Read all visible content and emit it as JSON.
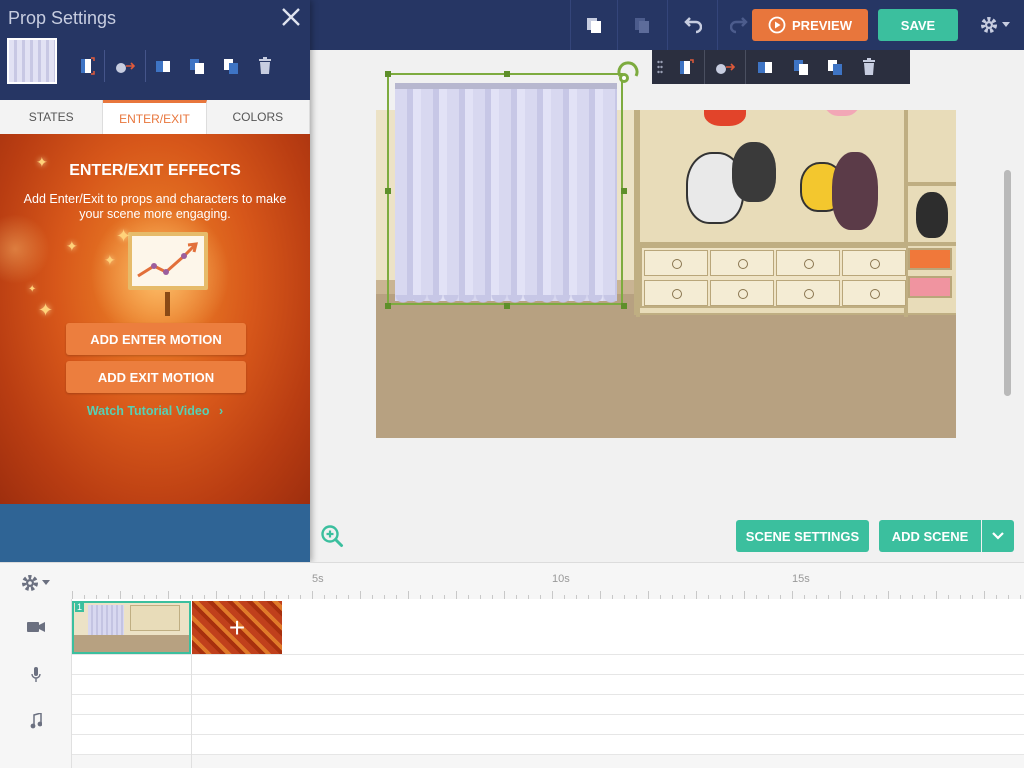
{
  "topbar": {
    "preview_label": "PREVIEW",
    "save_label": "SAVE",
    "settings_icon": "gear-icon"
  },
  "panel": {
    "title": "Prop Settings",
    "tabs": [
      {
        "label": "STATES",
        "active": false
      },
      {
        "label": "ENTER/EXIT",
        "active": true
      },
      {
        "label": "COLORS",
        "active": false
      }
    ],
    "effects_title": "ENTER/EXIT EFFECTS",
    "effects_desc": "Add Enter/Exit to props and characters to make your scene more engaging.",
    "add_enter_label": "ADD ENTER MOTION",
    "add_exit_label": "ADD EXIT MOTION",
    "tutorial_label": "Watch Tutorial Video",
    "tutorial_chevron": "›"
  },
  "canvas": {
    "scene_settings_label": "SCENE SETTINGS",
    "add_scene_label": "ADD SCENE"
  },
  "timeline": {
    "ticks": [
      {
        "label": "5s"
      },
      {
        "label": "10s"
      },
      {
        "label": "15s"
      }
    ],
    "scene_number": "1",
    "add_symbol": "+"
  },
  "colors": {
    "accent_orange": "#e8763c",
    "accent_teal": "#3bbf9e",
    "navy": "#263664",
    "selection_green": "#7dab3f"
  }
}
